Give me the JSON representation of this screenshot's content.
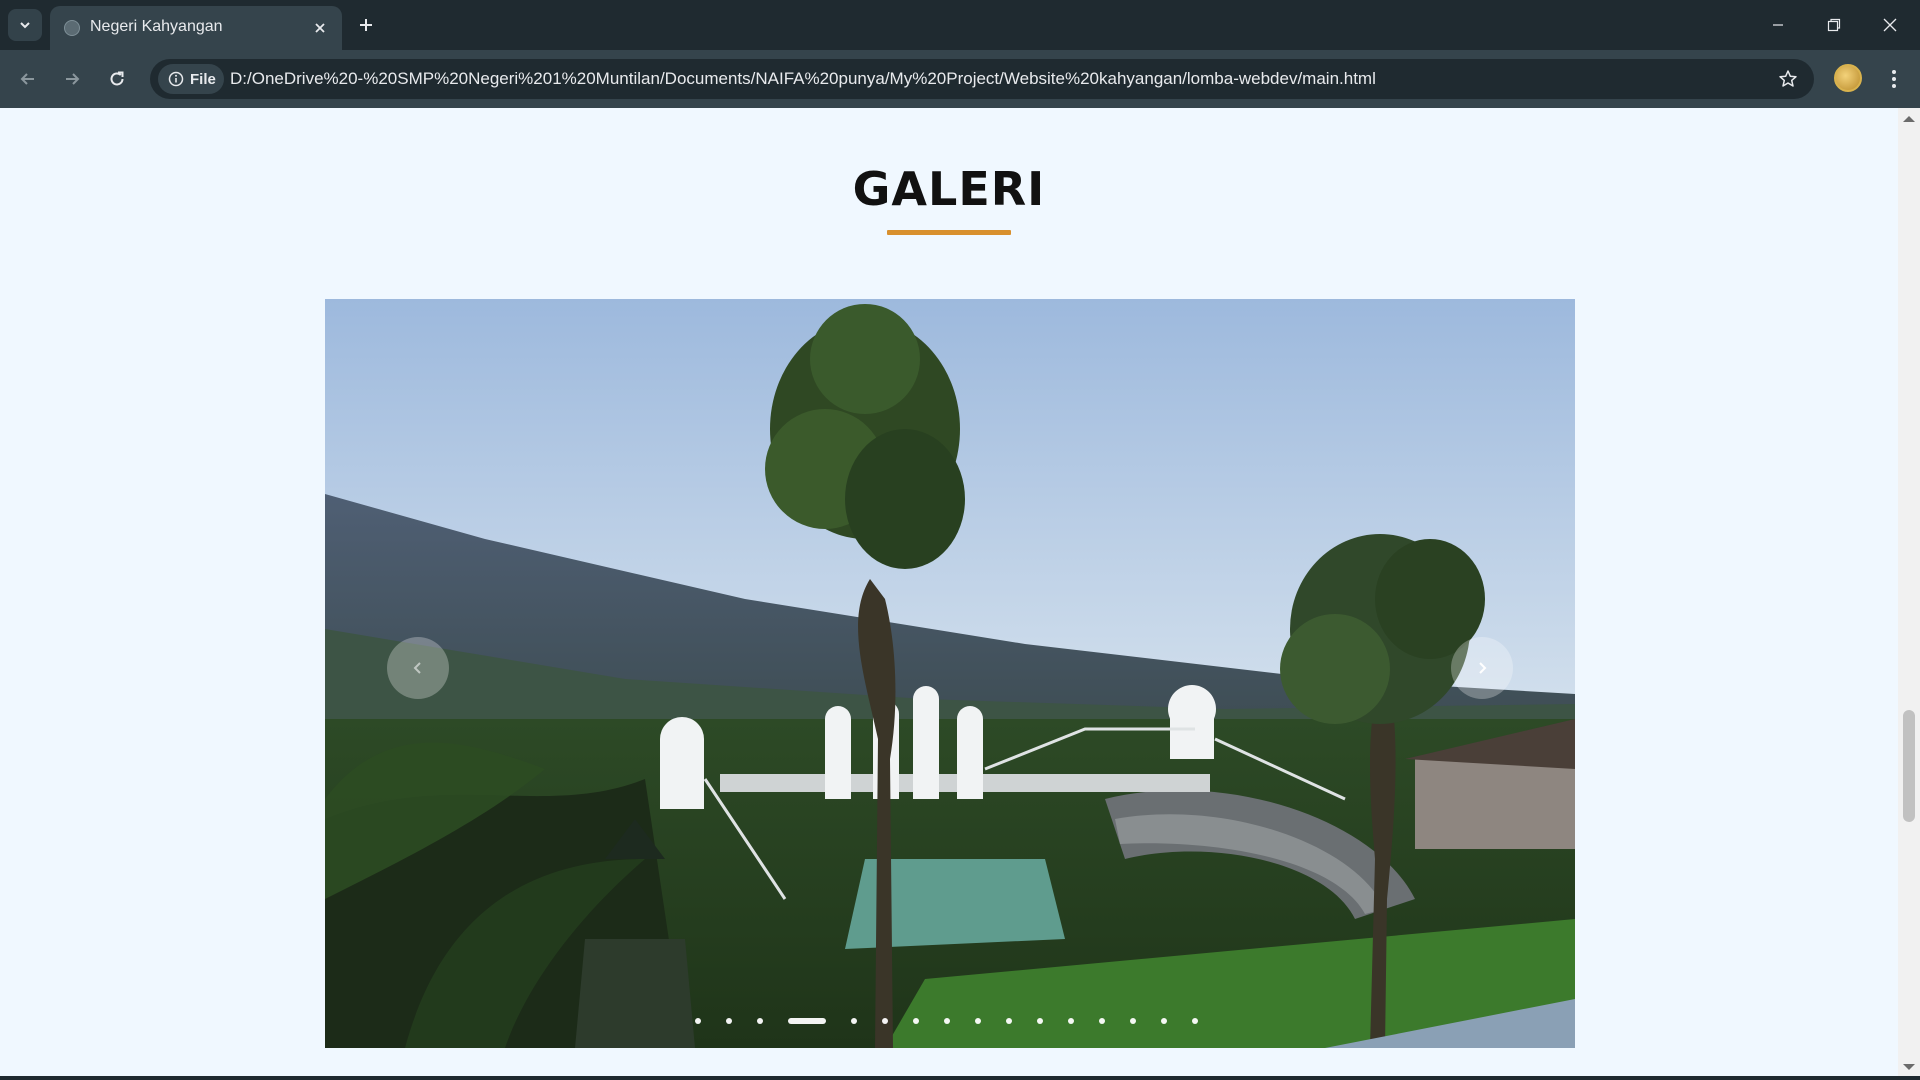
{
  "browser": {
    "tab_title": "Negeri Kahyangan",
    "site_chip_label": "File",
    "url": "D:/OneDrive%20-%20SMP%20Negeri%201%20Muntilan/Documents/NAIFA%20punya/My%20Project/Website%20kahyangan/lomba-webdev/main.html"
  },
  "page": {
    "section_title": "GALERI",
    "accent_color": "#d8902e",
    "background_color": "#f0f8ff"
  },
  "carousel": {
    "slide_count": 16,
    "active_index": 3,
    "prev_icon": "chevron-left-icon",
    "next_icon": "chevron-right-icon"
  }
}
